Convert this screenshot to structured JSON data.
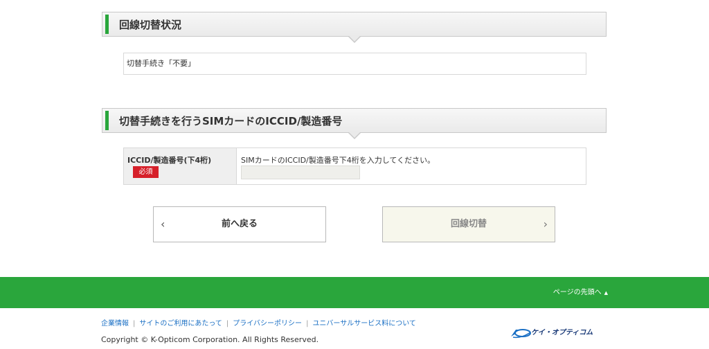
{
  "section1": {
    "title": "回線切替状況",
    "status_text": "切替手続き「不要」"
  },
  "section2": {
    "title": "切替手続きを行うSIMカードのICCID/製造番号",
    "field_label": "ICCID/製造番号(下4桁)",
    "required_badge": "必須",
    "help_text": "SIMカードのICCID/製造番号下4桁を入力してください。",
    "input_value": "",
    "input_placeholder": ""
  },
  "buttons": {
    "back_label": "前へ戻る",
    "next_label": "回線切替"
  },
  "page_top": {
    "label": "ページの先頭へ",
    "icon": "triangle-up-icon"
  },
  "footer": {
    "links": [
      "企業情報",
      "サイトのご利用にあたって",
      "プライバシーポリシー",
      "ユニバーサルサービス料について"
    ],
    "copyright": "Copyright © K-Opticom Corporation. All Rights Reserved.",
    "logo_text": "ケイ・オプティコム"
  },
  "colors": {
    "accent_green": "#2aa63c",
    "required_red": "#d6202a",
    "link_blue": "#1a6fc4"
  }
}
